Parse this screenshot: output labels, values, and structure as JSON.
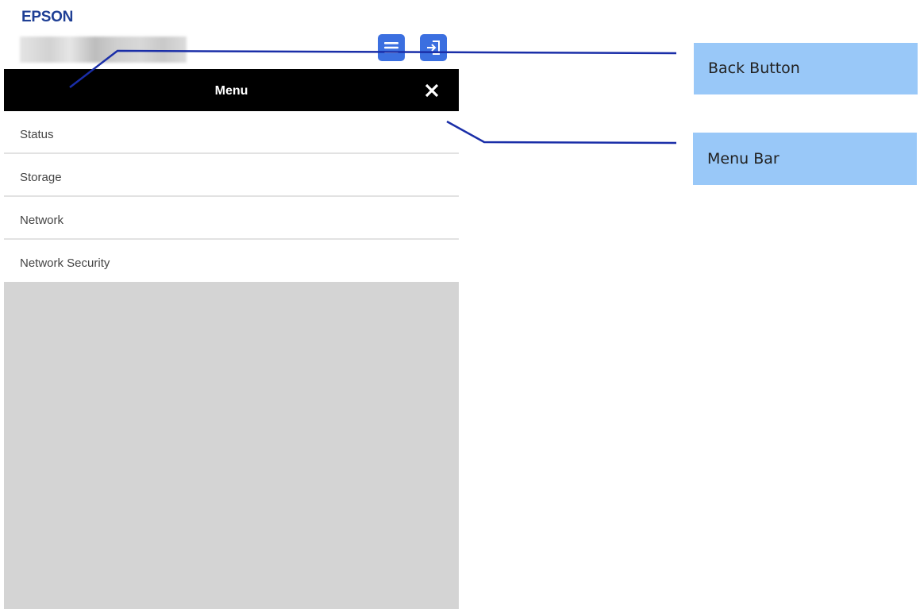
{
  "header": {
    "logo_text": "EPSON",
    "device_name_redacted": true,
    "menu_button_icon": "hamburger-icon",
    "login_button_icon": "login-icon",
    "button_color": "#3b6fe0"
  },
  "menubar": {
    "title": "Menu",
    "close_icon": "close-icon"
  },
  "menu": {
    "items": [
      {
        "label": "Status"
      },
      {
        "label": "Storage"
      },
      {
        "label": "Network"
      },
      {
        "label": "Network Security"
      }
    ]
  },
  "annotations": {
    "back_button_label": "Back Button",
    "menu_bar_label": "Menu Bar",
    "callout_color": "#99c8f8",
    "leader_color": "#1a2ea8"
  }
}
